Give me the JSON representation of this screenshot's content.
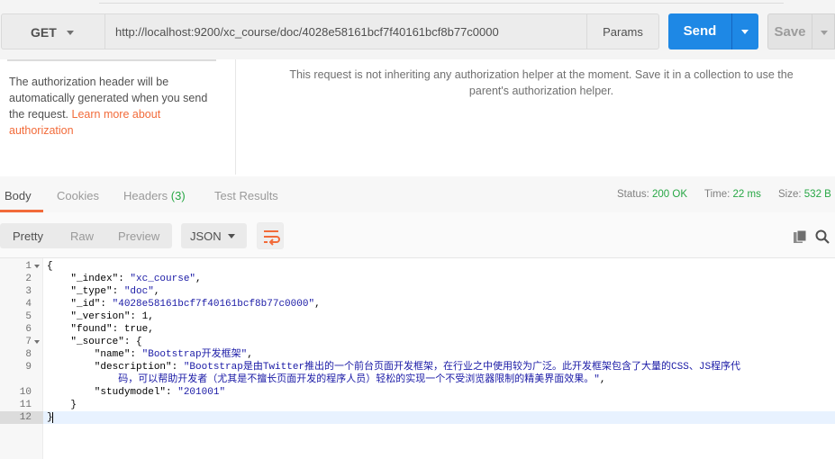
{
  "request": {
    "method": "GET",
    "url": "http://localhost:9200/xc_course/doc/4028e58161bcf7f40161bcf8b77c0000",
    "params_label": "Params",
    "send_label": "Send",
    "save_label": "Save"
  },
  "auth": {
    "left_text": "The authorization header will be automatically generated when you send the request.",
    "learn_more_link": "Learn more about authorization",
    "right_text": "This request is not inheriting any authorization helper at the moment. Save it in a collection to use the parent's authorization helper."
  },
  "response": {
    "tabs": [
      {
        "label": "Body"
      },
      {
        "label": "Cookies"
      },
      {
        "label": "Headers",
        "count": "(3)"
      },
      {
        "label": "Test Results"
      }
    ],
    "status_label": "Status:",
    "status_value": "200 OK",
    "time_label": "Time:",
    "time_value": "22 ms",
    "size_label": "Size:",
    "size_value": "532 B"
  },
  "toolbar": {
    "view_modes": [
      "Pretty",
      "Raw",
      "Preview"
    ],
    "format": "JSON"
  },
  "editor": {
    "lines": [
      {
        "num": "1",
        "fold": true,
        "parts": [
          [
            "k",
            "{"
          ]
        ]
      },
      {
        "num": "2",
        "parts": [
          [
            "k",
            "    \"_index\": "
          ],
          [
            "s",
            "\"xc_course\""
          ],
          [
            "k",
            ","
          ]
        ]
      },
      {
        "num": "3",
        "parts": [
          [
            "k",
            "    \"_type\": "
          ],
          [
            "s",
            "\"doc\""
          ],
          [
            "k",
            ","
          ]
        ]
      },
      {
        "num": "4",
        "parts": [
          [
            "k",
            "    \"_id\": "
          ],
          [
            "s",
            "\"4028e58161bcf7f40161bcf8b77c0000\""
          ],
          [
            "k",
            ","
          ]
        ]
      },
      {
        "num": "5",
        "parts": [
          [
            "k",
            "    \"_version\": 1,"
          ]
        ]
      },
      {
        "num": "6",
        "parts": [
          [
            "k",
            "    \"found\": true,"
          ]
        ]
      },
      {
        "num": "7",
        "fold": true,
        "parts": [
          [
            "k",
            "    \"_source\": {"
          ]
        ]
      },
      {
        "num": "8",
        "parts": [
          [
            "k",
            "        \"name\": "
          ],
          [
            "s",
            "\"Bootstrap开发框架\""
          ],
          [
            "k",
            ","
          ]
        ]
      },
      {
        "num": "9",
        "parts": [
          [
            "k",
            "        \"description\": "
          ],
          [
            "s",
            "\"Bootstrap是由Twitter推出的一个前台页面开发框架，在行业之中使用较为广泛。此开发框架包含了大量的CSS、JS程序代"
          ]
        ]
      },
      {
        "num": "",
        "parts": [
          [
            "s",
            "            码，可以帮助开发者（尤其是不擅长页面开发的程序人员）轻松的实现一个不受浏览器限制的精美界面效果。\""
          ],
          [
            "k",
            ","
          ]
        ]
      },
      {
        "num": "10",
        "parts": [
          [
            "k",
            "        \"studymodel\": "
          ],
          [
            "s",
            "\"201001\""
          ]
        ]
      },
      {
        "num": "11",
        "parts": [
          [
            "k",
            "    }"
          ]
        ]
      },
      {
        "num": "12",
        "parts": [
          [
            "k",
            "}"
          ]
        ]
      }
    ]
  }
}
